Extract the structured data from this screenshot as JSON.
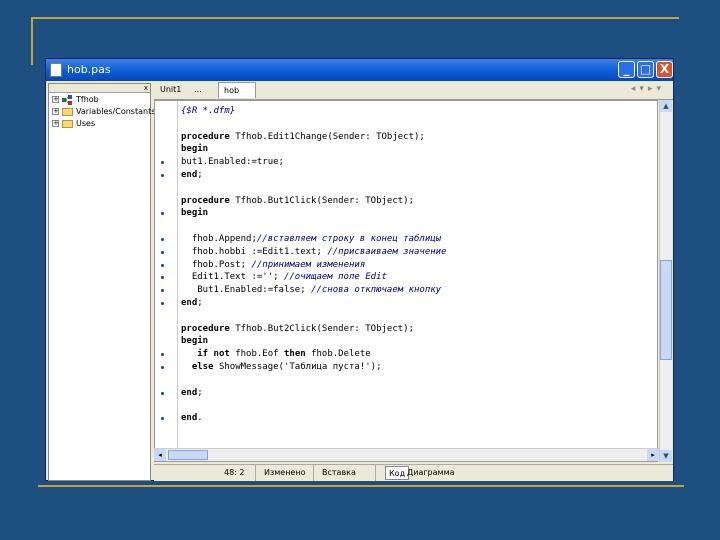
{
  "window": {
    "title": "hob.pas",
    "min_label": "_",
    "max_label": "□",
    "close_label": "X"
  },
  "tree": {
    "top_marker": "x",
    "items": [
      {
        "label": "Tfhob"
      },
      {
        "label": "Variables/Constants"
      },
      {
        "label": "Uses"
      }
    ]
  },
  "tabs": [
    {
      "label": "Unit1"
    },
    {
      "label": "..."
    },
    {
      "label": "hob"
    }
  ],
  "code_lines": [
    {
      "text": "{$R *.dfm}",
      "bp": false
    },
    {
      "text": "",
      "bp": false
    },
    {
      "text": "procedure Tfhob.Edit1Change(Sender: TObject);",
      "bp": false
    },
    {
      "text": "begin",
      "bp": false
    },
    {
      "text": "but1.Enabled:=true;",
      "bp": true
    },
    {
      "text": "end;",
      "bp": true
    },
    {
      "text": "",
      "bp": false
    },
    {
      "text": "procedure Tfhob.But1Click(Sender: TObject);",
      "bp": false
    },
    {
      "text": "begin",
      "bp": true
    },
    {
      "text": "",
      "bp": false
    },
    {
      "text": "  fhob.Append;//вставляем строку в конец таблицы",
      "bp": true
    },
    {
      "text": "  fhob.hobbi :=Edit1.text; //присваиваем значение",
      "bp": true
    },
    {
      "text": "  fhob.Post; //принимаем изменения",
      "bp": true
    },
    {
      "text": "  Edit1.Text :=''; //очищаем поле Edit",
      "bp": true
    },
    {
      "text": "   But1.Enabled:=false; //снова отключаем кнопку",
      "bp": true
    },
    {
      "text": "end;",
      "bp": true
    },
    {
      "text": "",
      "bp": false
    },
    {
      "text": "procedure Tfhob.But2Click(Sender: TObject);",
      "bp": false
    },
    {
      "text": "begin",
      "bp": false
    },
    {
      "text": "   if not fhob.Eof then fhob.Delete",
      "bp": true
    },
    {
      "text": "  else ShowMessage('Таблица пуста!');",
      "bp": true
    },
    {
      "text": "",
      "bp": false
    },
    {
      "text": "end;",
      "bp": true
    },
    {
      "text": "",
      "bp": false
    },
    {
      "text": "end.",
      "bp": true
    }
  ],
  "status": {
    "position": "48: 2",
    "state": "Изменено",
    "mode": "Вставка",
    "tab_code": "Код",
    "tab_diagram": "Диаграмма"
  },
  "colors": {
    "background": "#1d4f80",
    "accent_line": "#c8a13c",
    "titlebar": "#0a5ad4"
  }
}
